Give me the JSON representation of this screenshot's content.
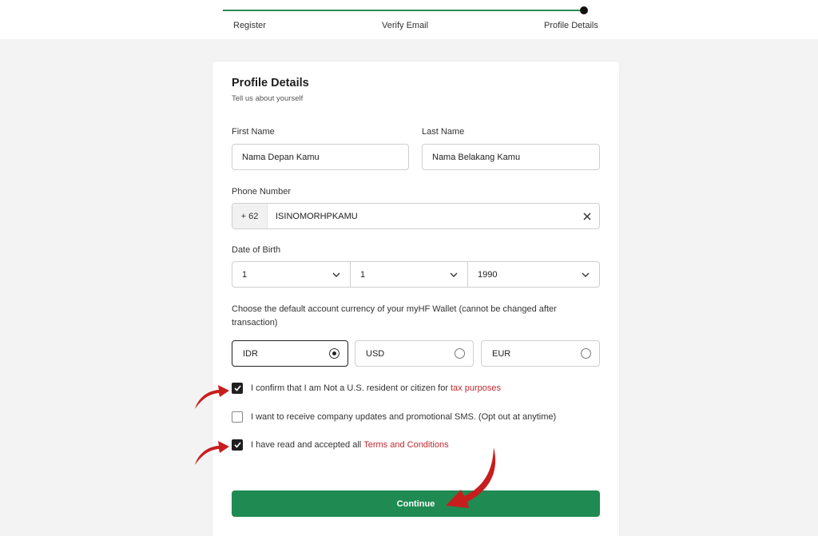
{
  "stepper": {
    "steps": [
      "Register",
      "Verify Email",
      "Profile Details"
    ],
    "current": 3
  },
  "form": {
    "title": "Profile Details",
    "subtitle": "Tell us about yourself",
    "first_name": {
      "label": "First Name",
      "value": "Nama Depan Kamu"
    },
    "last_name": {
      "label": "Last Name",
      "value": "Nama Belakang Kamu"
    },
    "phone": {
      "label": "Phone Number",
      "code": "+ 62",
      "value": "ISINOMORHPKAMU"
    },
    "dob": {
      "label": "Date of Birth",
      "day": "1",
      "month": "1",
      "year": "1990"
    },
    "currency": {
      "label": "Choose the default account currency of your myHF Wallet (cannot be changed after transaction)",
      "options": [
        "IDR",
        "USD",
        "EUR"
      ],
      "selected": "IDR"
    },
    "checks": {
      "us_resident": {
        "text": "I confirm that I am Not a U.S. resident or citizen for",
        "link": "tax purposes",
        "checked": true
      },
      "sms": {
        "text": "I want to receive company updates and promotional SMS. (Opt out at anytime)",
        "checked": false
      },
      "terms": {
        "text": "I have read and accepted all",
        "link": "Terms and Conditions",
        "checked": true
      }
    },
    "continue_label": "Continue"
  },
  "colors": {
    "accent_green": "#1f8a51",
    "link_red": "#c0282d",
    "arrow_red": "#c81d1d"
  },
  "icons": {
    "clear": "close-icon",
    "dropdown": "chevron-down-icon",
    "annotation": "red-arrow"
  }
}
